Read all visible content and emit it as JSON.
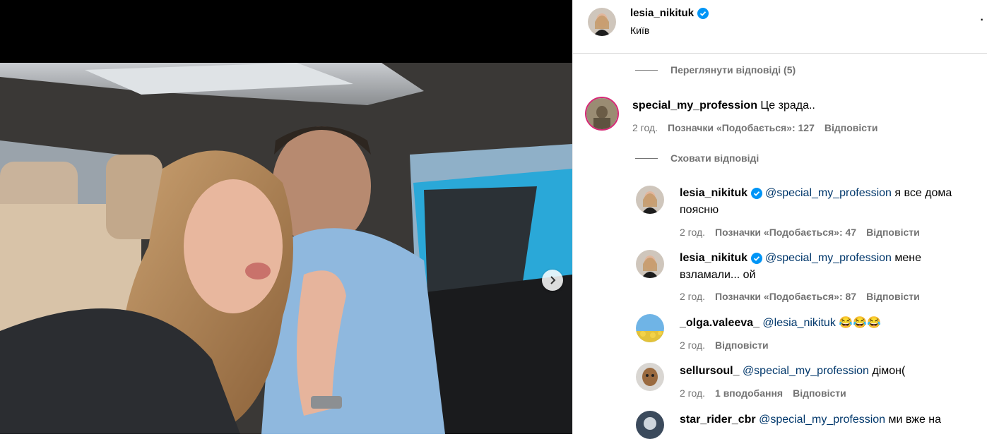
{
  "post": {
    "username": "lesia_nikituk",
    "location": "Київ"
  },
  "thread": {
    "view_replies": "Переглянути відповіді (5)",
    "hide_replies": "Сховати відповіді"
  },
  "comments": [
    {
      "username": "special_my_profession",
      "verified": false,
      "mention": "",
      "text": "Це зрада..",
      "time": "2 год.",
      "likes": "Позначки «Подобається»: 127",
      "reply": "Відповісти"
    }
  ],
  "replies": [
    {
      "username": "lesia_nikituk",
      "verified": true,
      "mention": "@special_my_profession",
      "text_line1": "я все дома",
      "text_line2": "поясню",
      "time": "2 год.",
      "likes": "Позначки «Подобається»: 47",
      "reply": "Відповісти"
    },
    {
      "username": "lesia_nikituk",
      "verified": true,
      "mention": "@special_my_profession",
      "text_line1": "мене",
      "text_line2": "взламали... ой",
      "time": "2 год.",
      "likes": "Позначки «Подобається»: 87",
      "reply": "Відповісти"
    },
    {
      "username": "_olga.valeeva_",
      "verified": false,
      "mention": "@lesia_nikituk",
      "text_line1": "😂😂😂",
      "time": "2 год.",
      "reply": "Відповісти"
    },
    {
      "username": "sellursoul_",
      "verified": false,
      "mention": "@special_my_profession",
      "text_line1": "дімон(",
      "time": "2 год.",
      "likes": "1 вподобання",
      "reply": "Відповісти"
    },
    {
      "username": "star_rider_cbr",
      "verified": false,
      "mention": "@special_my_profession",
      "text_line1": "ми вже на"
    }
  ],
  "colors": {
    "verified": "#0095f6",
    "mention": "#00376b",
    "meta": "#737373"
  }
}
